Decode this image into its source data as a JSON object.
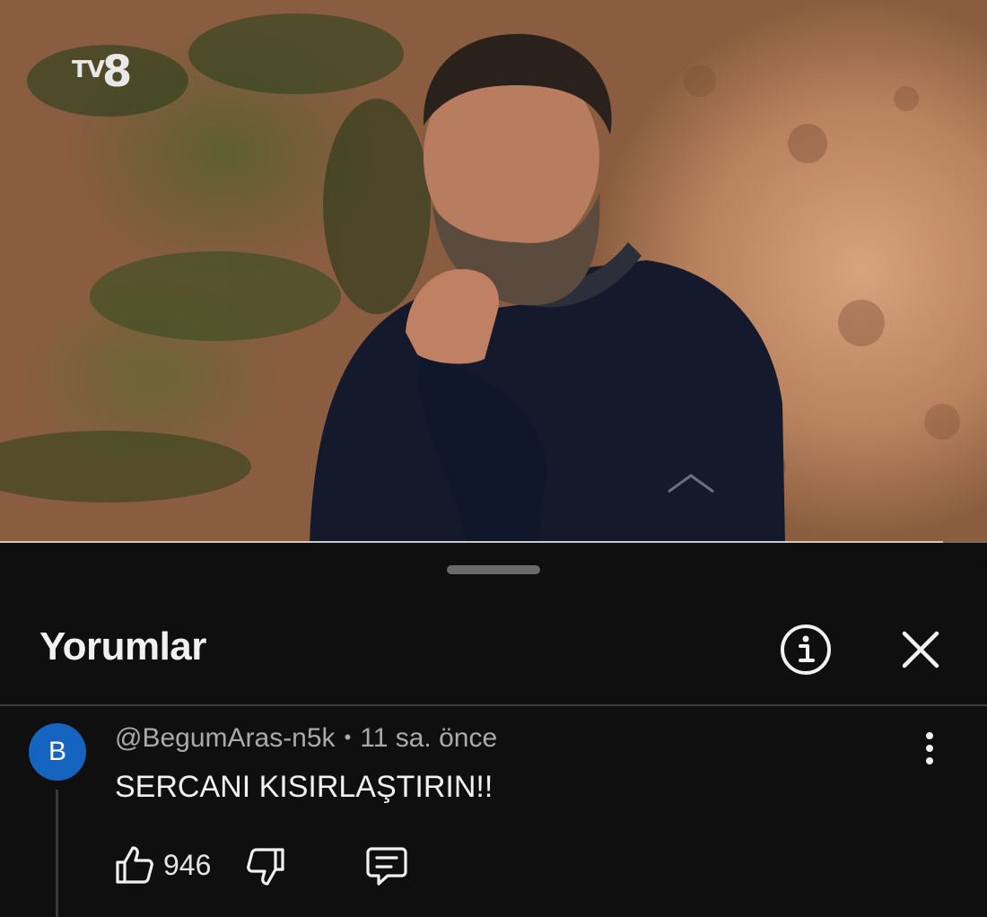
{
  "video": {
    "channel_logo": {
      "prefix": "TV",
      "suffix": "8"
    },
    "progress_fraction": 0.955,
    "progress_color": "#c9c9c9"
  },
  "comments_sheet": {
    "title": "Yorumlar",
    "info_icon": "info-circle-icon",
    "close_icon": "close-x-icon"
  },
  "comments": [
    {
      "avatar_letter": "B",
      "avatar_color": "#1565c0",
      "author": "@BegumAras-n5k",
      "separator": "•",
      "time": "11 sa. önce",
      "text": "SERCANI KISIRLAŞTIRIN!!",
      "like_count": "946",
      "icons": {
        "like": "thumbs-up-icon",
        "dislike": "thumbs-down-icon",
        "reply": "reply-comment-icon",
        "more": "more-vertical-icon"
      }
    }
  ]
}
